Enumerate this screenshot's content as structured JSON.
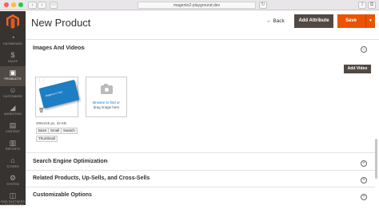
{
  "browser": {
    "url": "magento2-playground.dev"
  },
  "sidebar": {
    "items": [
      {
        "label": "DASHBOARD",
        "icon": "dashboard-icon",
        "glyph": "◔"
      },
      {
        "label": "SALES",
        "icon": "dollar-icon",
        "glyph": "$"
      },
      {
        "label": "PRODUCTS",
        "icon": "cube-icon",
        "glyph": "▣"
      },
      {
        "label": "CUSTOMERS",
        "icon": "person-icon",
        "glyph": "☺"
      },
      {
        "label": "MARKETING",
        "icon": "megaphone-icon",
        "glyph": "◢"
      },
      {
        "label": "CONTENT",
        "icon": "layout-icon",
        "glyph": "▤"
      },
      {
        "label": "REPORTS",
        "icon": "bar-chart-icon",
        "glyph": "▥"
      },
      {
        "label": "STORES",
        "icon": "storefront-icon",
        "glyph": "⌂"
      },
      {
        "label": "SYSTEM",
        "icon": "gear-icon",
        "glyph": "⚙"
      },
      {
        "label": "FIND PARTNERS & EXTENSIONS",
        "icon": "puzzle-icon",
        "glyph": "◫"
      }
    ]
  },
  "header": {
    "title": "New Product",
    "back_label": "Back",
    "add_attribute_label": "Add Attribute",
    "save_label": "Save"
  },
  "images_section": {
    "title": "Images And Videos",
    "add_video_label": "Add Video",
    "image": {
      "caption": "Magento 2 Card",
      "meta": "309x245 px, 32 KB",
      "roles": [
        "Base",
        "Small",
        "Swatch",
        "Thumbnail"
      ]
    },
    "uploader": {
      "line1": "Browse to find or",
      "line2": "drag image here"
    }
  },
  "sections": [
    {
      "title": "Search Engine Optimization"
    },
    {
      "title": "Related Products, Up-Sells, and Cross-Sells"
    },
    {
      "title": "Customizable Options"
    }
  ],
  "colors": {
    "sidebar_bg": "#373330",
    "primary_button": "#eb5202",
    "secondary_button": "#514943",
    "link": "#007bdb"
  }
}
